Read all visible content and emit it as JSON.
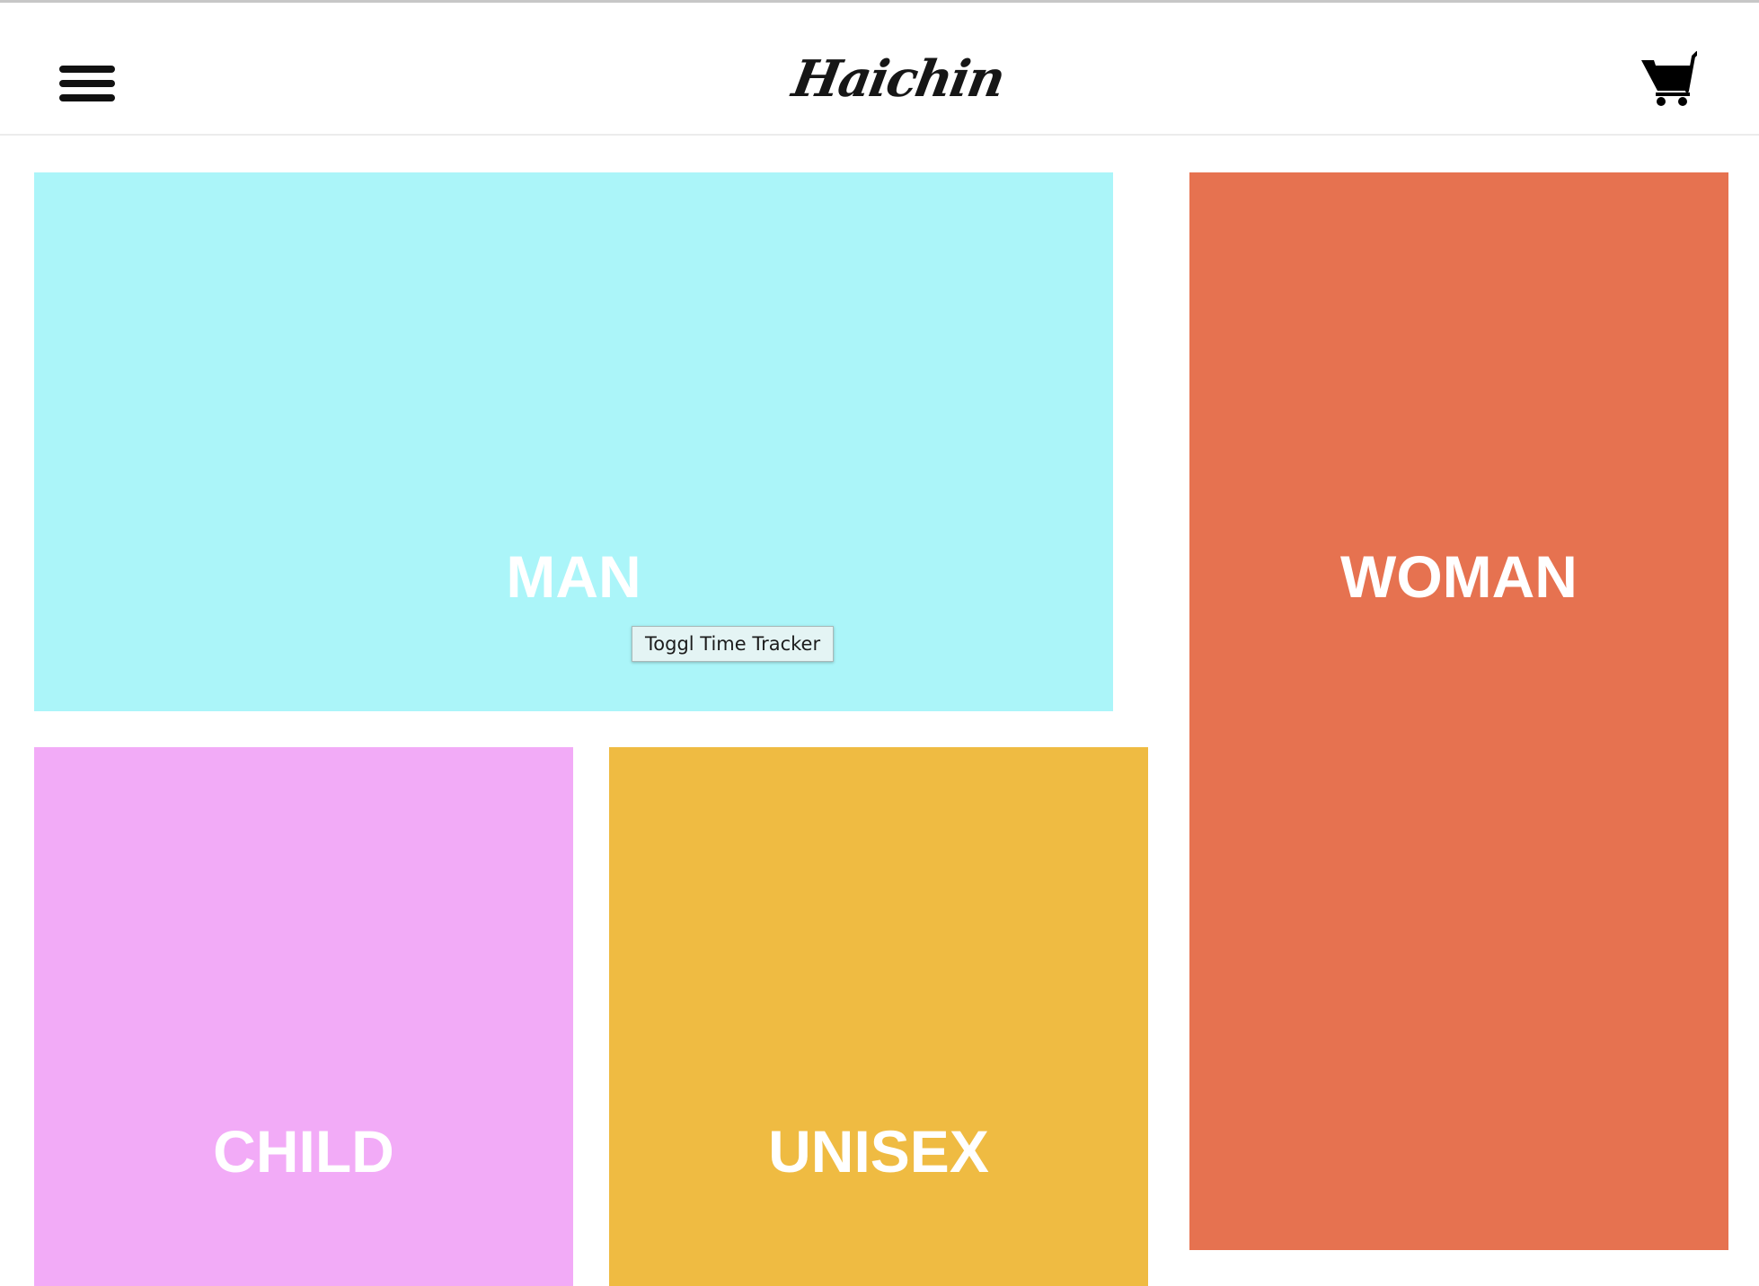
{
  "header": {
    "logo_text": "Haichin",
    "menu_icon": "hamburger-menu-icon",
    "cart_icon": "shopping-cart-icon"
  },
  "categories": [
    {
      "label": "MAN",
      "color": "#abf5f9"
    },
    {
      "label": "WOMAN",
      "color": "#e67250"
    },
    {
      "label": "CHILD",
      "color": "#f2abf7"
    },
    {
      "label": "UNISEX",
      "color": "#efbb42"
    }
  ],
  "tooltip": {
    "text": "Toggl Time Tracker"
  }
}
